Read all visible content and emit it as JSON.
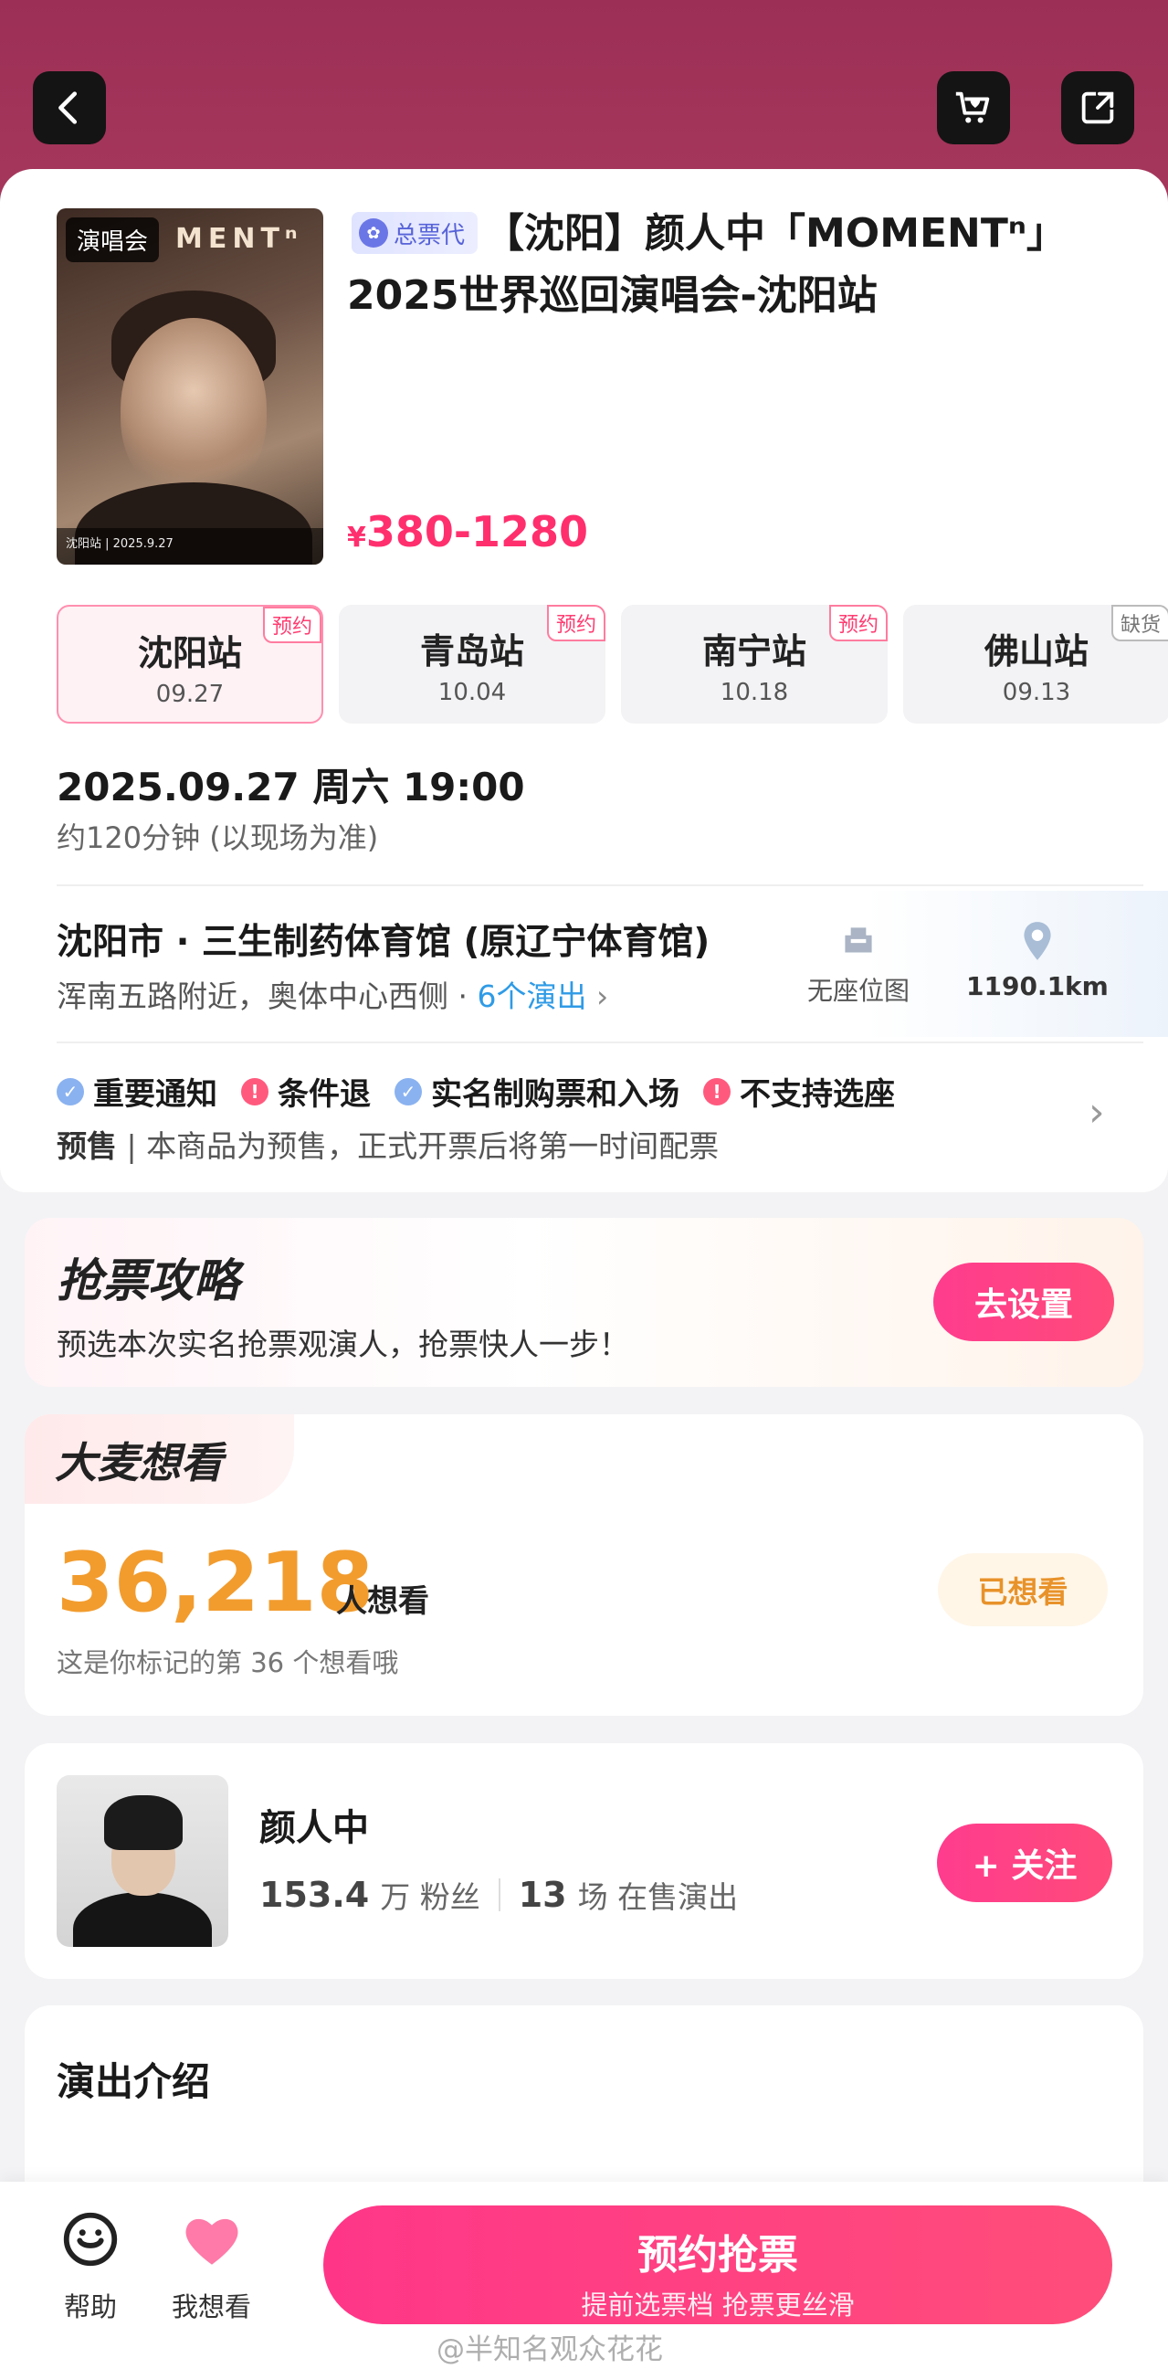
{
  "header": {
    "accent": "#a2335a"
  },
  "poster": {
    "tag": "演唱会",
    "title": "MENTⁿ",
    "footer": "沈阳站 | 2025.9.27"
  },
  "event": {
    "badge": "总票代",
    "title": "【沈阳】颜人中「MOMENTⁿ」2025世界巡回演唱会-沈阳站",
    "price_symbol": "¥",
    "price": "380-1280"
  },
  "stations": [
    {
      "name": "沈阳站",
      "date": "09.27",
      "tag": "预约",
      "active": true
    },
    {
      "name": "青岛站",
      "date": "10.04",
      "tag": "预约",
      "active": false
    },
    {
      "name": "南宁站",
      "date": "10.18",
      "tag": "预约",
      "active": false
    },
    {
      "name": "佛山站",
      "date": "09.13",
      "tag": "缺货",
      "active": false
    }
  ],
  "schedule": {
    "datetime": "2025.09.27 周六 19:00",
    "duration": "约120分钟 (以现场为准)"
  },
  "venue": {
    "name": "沈阳市 · 三生制药体育馆 (原辽宁体育馆)",
    "address": "浑南五路附近，奥体中心西侧 · ",
    "shows": "6个演出",
    "seat_map": "无座位图",
    "distance": "1190.1km"
  },
  "notices": {
    "items": [
      {
        "label": "重要通知",
        "type": "ok"
      },
      {
        "label": "条件退",
        "type": "warn"
      },
      {
        "label": "实名制购票和入场",
        "type": "ok"
      },
      {
        "label": "不支持选座",
        "type": "warn"
      }
    ],
    "presale_label": "预售",
    "presale_text": " | 本商品为预售，正式开票后将第一时间配票"
  },
  "strategy": {
    "title": "抢票攻略",
    "subtitle": "预选本次实名抢票观演人，抢票快人一步！",
    "button": "去设置"
  },
  "want": {
    "tag": "大麦想看",
    "count": "36,218",
    "unit": "人想看",
    "subtitle": "这是你标记的第 36 个想看哦",
    "button": "已想看"
  },
  "artist": {
    "name": "颜人中",
    "fans_num": "153.4",
    "fans_label": "万 粉丝",
    "shows_num": "13",
    "shows_label": "场 在售演出",
    "follow": "+ 关注"
  },
  "intro": {
    "title": "演出介绍"
  },
  "bottom": {
    "help": "帮助",
    "want": "我想看",
    "main": "预约抢票",
    "main_sub": "提前选票档 抢票更丝滑"
  },
  "watermark": "@半知名观众花花"
}
